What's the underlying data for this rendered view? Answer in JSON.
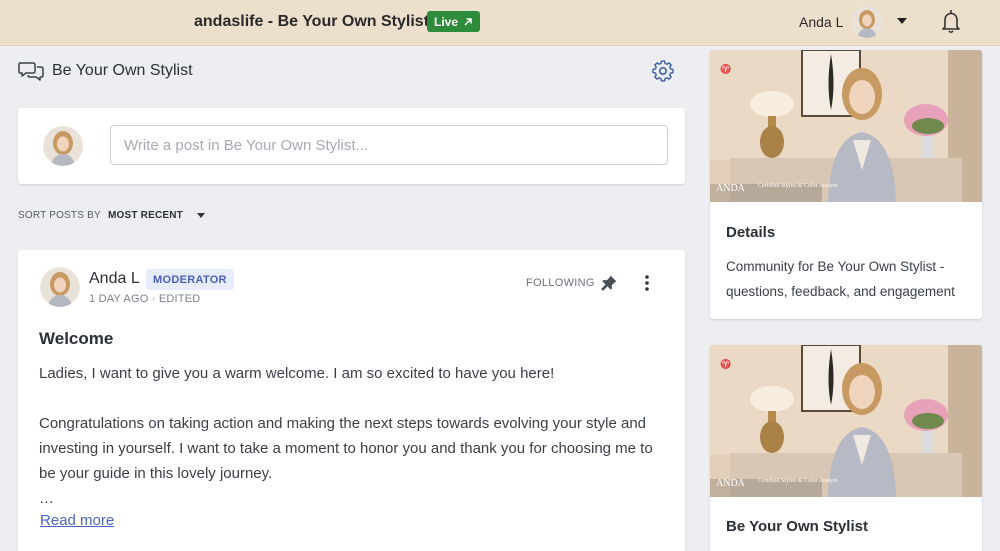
{
  "topbar": {
    "site_title": "andaslife - Be Your Own Stylist",
    "live_label": "Live",
    "user_name": "Anda L"
  },
  "community": {
    "title": "Be Your Own Stylist"
  },
  "composer": {
    "placeholder": "Write a post in Be Your Own Stylist..."
  },
  "sort": {
    "label": "SORT POSTS BY",
    "value": "MOST RECENT"
  },
  "post": {
    "author": "Anda L",
    "badge": "MODERATOR",
    "meta": "1 DAY AGO · EDITED",
    "following": "FOLLOWING",
    "title": "Welcome",
    "paragraphs": [
      "Ladies, I want to give you a warm welcome. I am so excited to have you here!",
      "Congratulations on taking action and making the next steps towards evolving your style and investing in yourself. I want to take a moment to honor you and thank you for choosing me to be your guide in this lovely journey.",
      "…"
    ],
    "read_more": "Read more"
  },
  "cards": [
    {
      "title": "Details",
      "description": "Community for Be Your Own Stylist - questions, feedback, and engagement",
      "image_caption": "ANDA",
      "image_subcaption": "Certified Stylist & Color Analyst"
    },
    {
      "title": "Be Your Own Stylist",
      "image_caption": "ANDA",
      "image_subcaption": "Certified Stylist & Color Analyst"
    }
  ],
  "colors": {
    "topbar_bg": "#ecdfcc",
    "live_green": "#2e8b3b",
    "moderator_bg": "#e7ecfa",
    "moderator_text": "#4a5fb8",
    "link": "#4a64c0",
    "page_bg": "#eceef1"
  },
  "icons": {
    "community": "chat-bubbles-icon",
    "settings": "gear-icon",
    "notifications": "bell-icon",
    "live": "external-arrow-icon",
    "pin": "pin-icon",
    "more": "kebab-menu-icon"
  }
}
